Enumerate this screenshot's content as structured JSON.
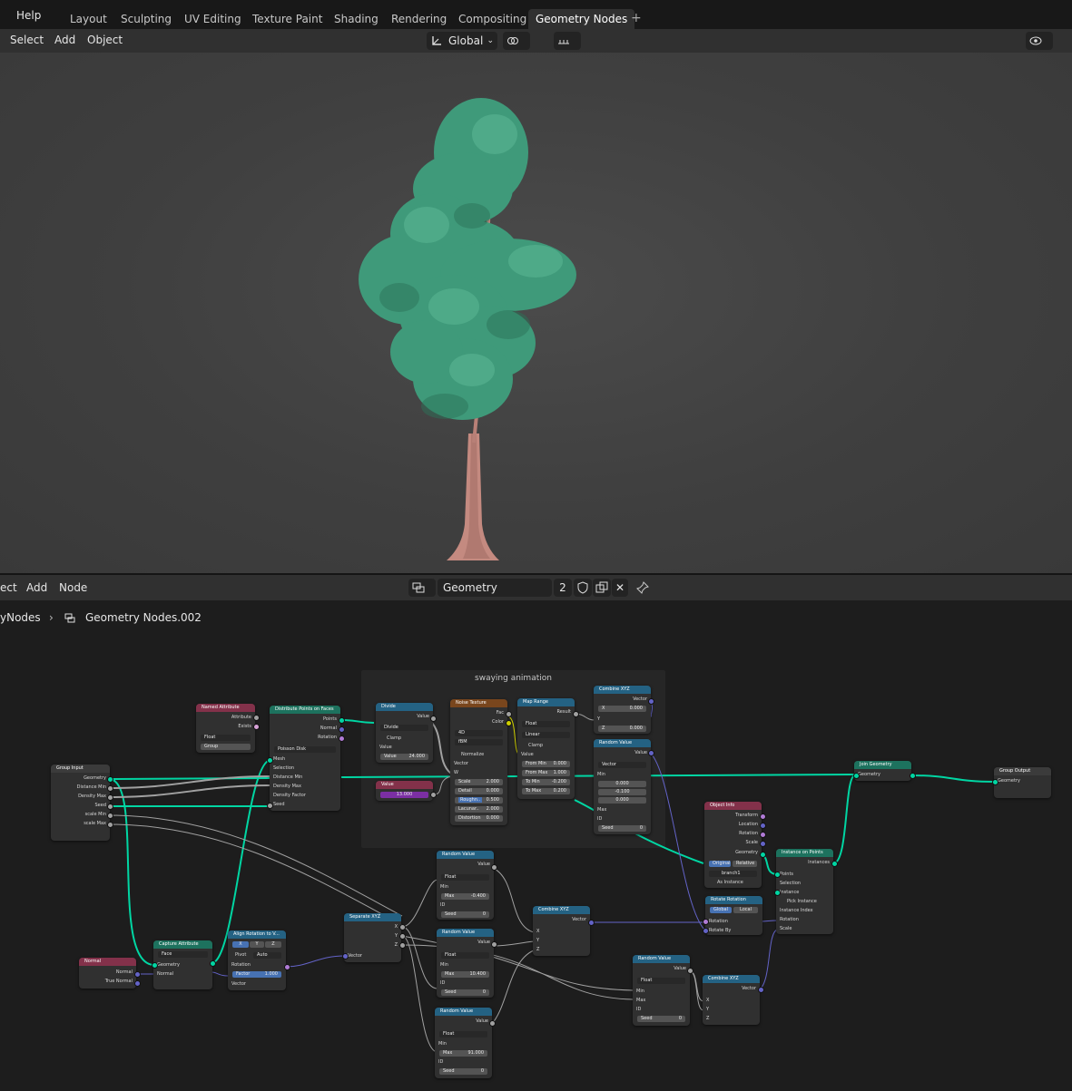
{
  "topbar": {
    "help_label": "Help",
    "tabs": [
      "Layout",
      "Sculpting",
      "UV Editing",
      "Texture Paint",
      "Shading",
      "Rendering",
      "Compositing",
      "Geometry Nodes"
    ],
    "active_tab": "Geometry Nodes",
    "add_tab_icon": "plus-icon"
  },
  "header3d": {
    "menu": [
      "Select",
      "Add",
      "Object"
    ],
    "orientation": "Global",
    "icons": [
      "transform-orientation-icon",
      "pivot-icon",
      "snap-icon",
      "snap-increment-icon",
      "proportional-edit-icon",
      "falloff-icon",
      "visibility-icon",
      "gizmo-icon"
    ]
  },
  "node_header": {
    "menu": [
      "ect",
      "Add",
      "Node"
    ],
    "node_group_name": "Geometry Nodes.002",
    "user_count": "2",
    "icons": [
      "node-tree-icon",
      "fake-user-shield-icon",
      "duplicate-icon",
      "close-icon",
      "pin-icon"
    ]
  },
  "breadcrumb": {
    "parent": "yNodes",
    "current": "Geometry Nodes.002"
  },
  "frame": {
    "label": "swaying animation"
  },
  "nodes": {
    "group_input": {
      "title": "Group Input",
      "outputs": [
        "Geometry",
        "Distance Min",
        "Density Max",
        "Seed",
        "scale Min",
        "scale Max"
      ]
    },
    "named_attribute": {
      "title": "Named Attribute",
      "outputs": [
        "Attribute",
        "Exists"
      ],
      "type": "Float",
      "name": "Group"
    },
    "distribute": {
      "title": "Distribute Points on Faces",
      "outputs": [
        "Points",
        "Normal",
        "Rotation"
      ],
      "method": "Poisson Disk",
      "inputs": [
        "Mesh",
        "Selection",
        "Distance Min",
        "Density Max",
        "Density Factor",
        "Seed"
      ]
    },
    "divide": {
      "title": "Divide",
      "output": "Value",
      "op": "Divide",
      "clamp": "Clamp",
      "in_value": "Value",
      "value_label": "Value",
      "value": "24.000"
    },
    "value_node": {
      "title": "Value",
      "value": "13.000"
    },
    "noise": {
      "title": "Noise Texture",
      "outputs": [
        "Fac",
        "Color"
      ],
      "dim": "4D",
      "type": "fBM",
      "normalize": "Normalize",
      "inputs": [
        "Vector",
        "W"
      ],
      "fields": [
        [
          "Scale",
          "2.000"
        ],
        [
          "Detail",
          "0.000"
        ],
        [
          "Roughn..",
          "0.500"
        ],
        [
          "Lacunar..",
          "2.000"
        ],
        [
          "Distortion",
          "0.000"
        ]
      ]
    },
    "map_range": {
      "title": "Map Range",
      "output": "Result",
      "type": "Float",
      "interp": "Linear",
      "clamp": "Clamp",
      "in_value": "Value",
      "fields": [
        [
          "From Min",
          "0.000"
        ],
        [
          "From Max",
          "1.000"
        ],
        [
          "To Min",
          "-0.200"
        ],
        [
          "To Max",
          "0.200"
        ]
      ]
    },
    "combine_xyz_top": {
      "title": "Combine XYZ",
      "output": "Vector",
      "x": [
        "X",
        "0.000"
      ],
      "y": "Y",
      "z": [
        "Z",
        "0.000"
      ]
    },
    "random_vector": {
      "title": "Random Value",
      "output": "Value",
      "type": "Vector",
      "min_label": "Min",
      "min_values": [
        "0.000",
        "-0.100",
        "0.000"
      ],
      "max_label": "Max",
      "id_label": "ID",
      "seed": [
        "Seed",
        "0"
      ]
    },
    "join_geometry": {
      "title": "Join Geometry",
      "input": "Geometry"
    },
    "group_output": {
      "title": "Group Output",
      "input": "Geometry"
    },
    "object_info": {
      "title": "Object Info",
      "outputs": [
        "Transform",
        "Location",
        "Rotation",
        "Scale",
        "Geometry"
      ],
      "modes": [
        "Original",
        "Relative"
      ],
      "object": "branch1",
      "as_instance": "As Instance"
    },
    "instance_on_points": {
      "title": "Instance on Points",
      "output": "Instances",
      "inputs": [
        "Points",
        "Selection",
        "Instance",
        "Pick Instance",
        "Instance Index",
        "Rotation",
        "Scale"
      ]
    },
    "rotate_rotation": {
      "title": "Rotate Rotation",
      "modes": [
        "Global",
        "Local"
      ],
      "inputs": [
        "Rotation",
        "Rotate By"
      ]
    },
    "random_1": {
      "title": "Random Value",
      "output": "Value",
      "type": "Float",
      "min": "Min",
      "max": [
        "Max",
        "-0.400"
      ],
      "id": "ID",
      "seed": [
        "Seed",
        "0"
      ]
    },
    "random_2": {
      "title": "Random Value",
      "output": "Value",
      "type": "Float",
      "min": "Min",
      "max": [
        "Max",
        "10.400"
      ],
      "id": "ID",
      "seed": [
        "Seed",
        "0"
      ]
    },
    "random_3": {
      "title": "Random Value",
      "output": "Value",
      "type": "Float",
      "min": "Min",
      "max": [
        "Max",
        "91.000"
      ],
      "id": "ID",
      "seed": [
        "Seed",
        "0"
      ]
    },
    "random_4": {
      "title": "Random Value",
      "output": "Value",
      "type": "Float",
      "min": "Min",
      "max": "Max",
      "id": "ID",
      "seed": [
        "Seed",
        "0"
      ]
    },
    "combine_xyz_mid": {
      "title": "Combine XYZ",
      "output": "Vector",
      "inputs": [
        "X",
        "Y",
        "Z"
      ]
    },
    "combine_xyz_low": {
      "title": "Combine XYZ",
      "output": "Vector",
      "inputs": [
        "X",
        "Y",
        "Z"
      ]
    },
    "separate_xyz": {
      "title": "Separate XYZ",
      "outputs": [
        "X",
        "Y",
        "Z"
      ],
      "input": "Vector"
    },
    "capture": {
      "title": "Capture Attribute",
      "domain": "Face",
      "geometry": "Geometry",
      "normal": "Normal"
    },
    "align": {
      "title": "Align Rotation to V...",
      "axes": [
        "X",
        "Y",
        "Z"
      ],
      "pivot": "Pivot",
      "pivot_val": "Auto",
      "rotation": "Rotation",
      "factor": [
        "Factor",
        "1.000"
      ],
      "vector": "Vector"
    },
    "normal": {
      "title": "Normal",
      "outputs": [
        "Normal",
        "True Normal"
      ]
    }
  },
  "colors": {
    "geometry_wire": "#00d6a3",
    "float_wire": "#a1a1a1",
    "vector_wire": "#6363c7",
    "header_geometry": "#1d725e",
    "header_input": "#83314a",
    "header_converter": "#246283",
    "header_texture": "#79461d",
    "header_group": "#3b3b3b",
    "active_tab_bg": "#303030",
    "tree_leaf": "#3f9a7a",
    "tree_trunk": "#c48a80"
  }
}
